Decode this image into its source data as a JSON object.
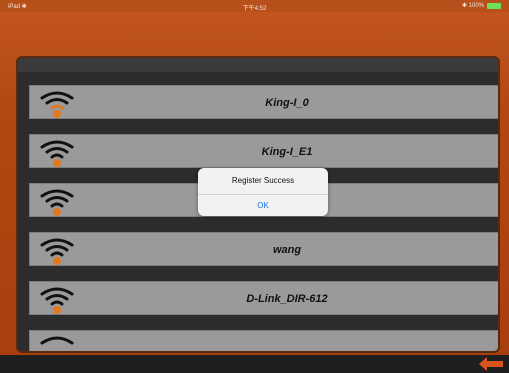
{
  "status_bar": {
    "left": "iPad ✱",
    "time": "下午4:52",
    "right": "✱ 100%",
    "battery_color": "#6ee05c"
  },
  "accent_color": "#b24712",
  "networks": [
    {
      "name": "King-I_0",
      "icon": "wifi-icon"
    },
    {
      "name": "King-I_E1",
      "icon": "wifi-icon"
    },
    {
      "name": "",
      "icon": "wifi-icon"
    },
    {
      "name": "wang",
      "icon": "wifi-icon"
    },
    {
      "name": "D-Link_DIR-612",
      "icon": "wifi-icon"
    },
    {
      "name": "",
      "icon": "wifi-icon"
    }
  ],
  "dialog": {
    "message": "Register Success",
    "ok_label": "OK"
  },
  "bottom_bar": {
    "back_icon": "back-arrow-icon"
  }
}
